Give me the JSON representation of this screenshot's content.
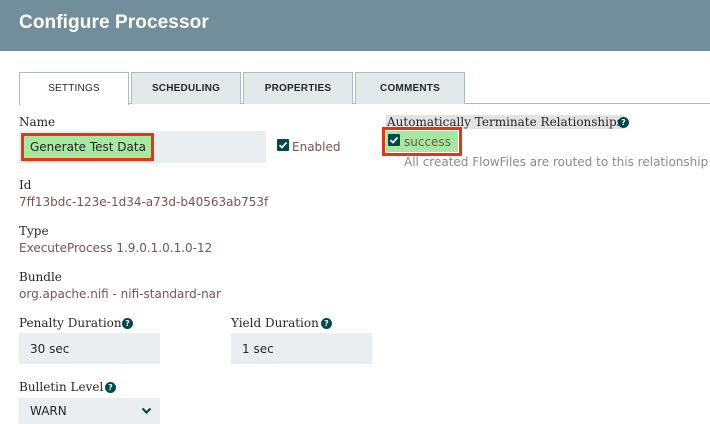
{
  "window": {
    "title": "Configure Processor"
  },
  "tabs": [
    {
      "label": "SETTINGS",
      "active": true
    },
    {
      "label": "SCHEDULING",
      "active": false
    },
    {
      "label": "PROPERTIES",
      "active": false
    },
    {
      "label": "COMMENTS",
      "active": false
    }
  ],
  "settings": {
    "name_label": "Name",
    "name_value": "Generate Test Data",
    "enabled_label": "Enabled",
    "enabled_checked": true,
    "id_label": "Id",
    "id_value": "7ff13bdc-123e-1d34-a73d-b40563ab753f",
    "type_label": "Type",
    "type_value": "ExecuteProcess 1.9.0.1.0.1.0-12",
    "bundle_label": "Bundle",
    "bundle_value": "org.apache.nifi - nifi-standard-nar",
    "penalty_label": "Penalty Duration",
    "penalty_value": "30 sec",
    "yield_label": "Yield Duration",
    "yield_value": "1 sec",
    "bulletin_label": "Bulletin Level",
    "bulletin_value": "WARN"
  },
  "relationships": {
    "title": "Automatically Terminate Relationships",
    "items": [
      {
        "name": "success",
        "checked": true,
        "description": "All created FlowFiles are routed to this relationship"
      }
    ]
  },
  "colors": {
    "header": "#728e9b",
    "highlight": "#e8350d",
    "highlight_fill": "#a7e8a0",
    "value_text": "#775351",
    "checkbox": "#004849"
  }
}
